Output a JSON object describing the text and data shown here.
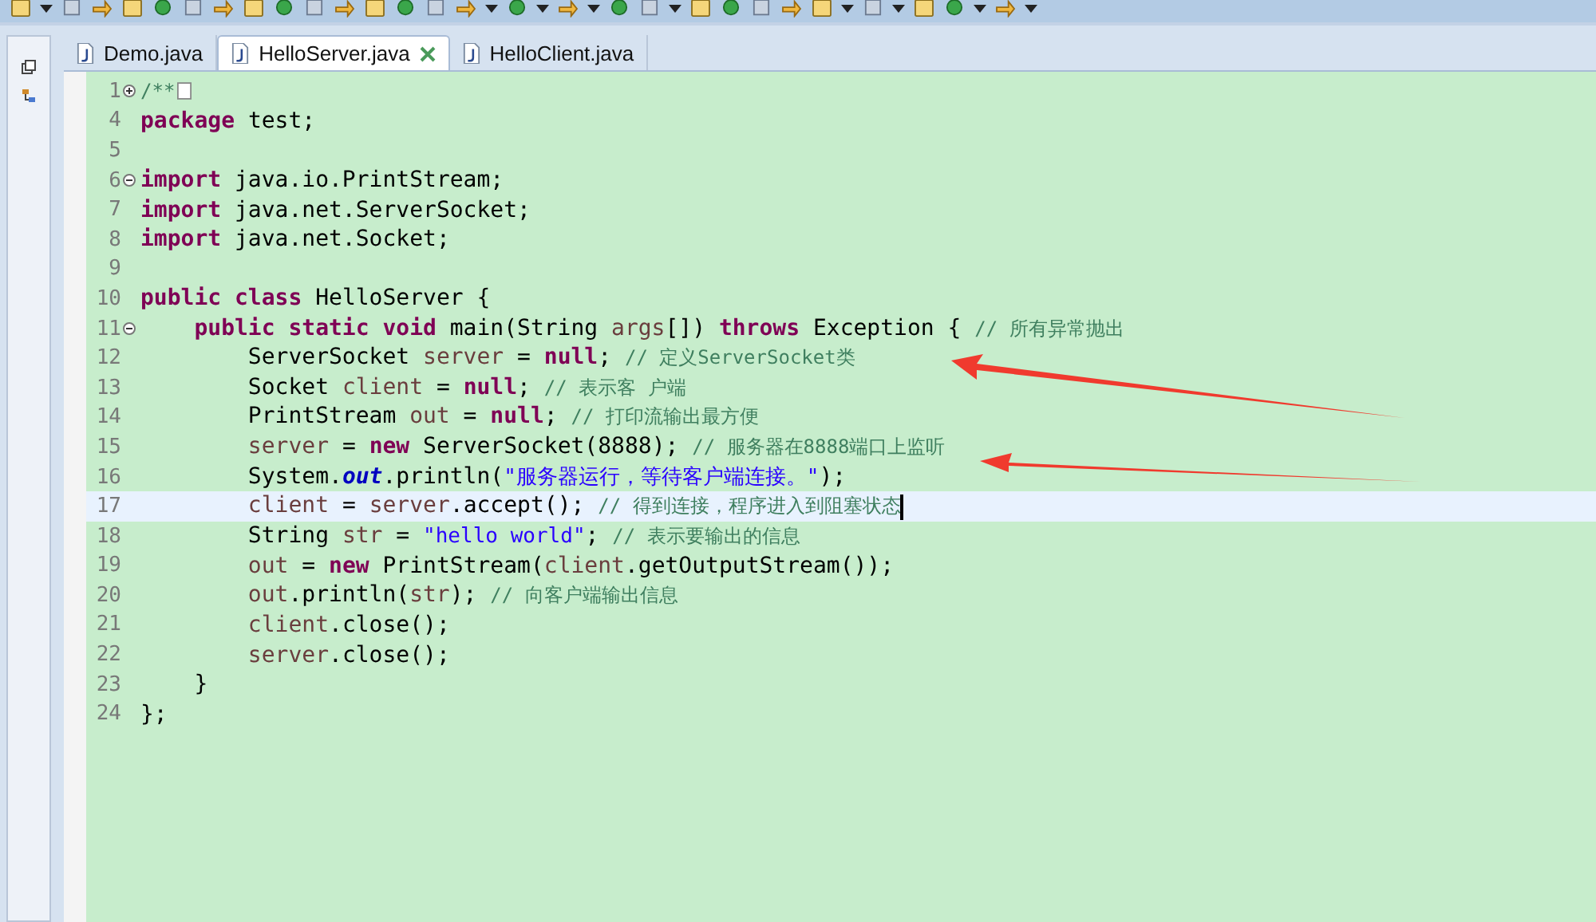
{
  "tabs": [
    {
      "label": "Demo.java",
      "selected": false
    },
    {
      "label": "HelloServer.java",
      "selected": true
    },
    {
      "label": "HelloClient.java",
      "selected": false
    }
  ],
  "editor": {
    "lines": [
      {
        "number": "1",
        "expanded": false,
        "tokens": [
          {
            "kind": "comment",
            "text": "/**"
          }
        ]
      },
      {
        "number": "4",
        "tokens": [
          {
            "kind": "keyword",
            "text": "package"
          },
          {
            "kind": "text",
            "text": " test;"
          }
        ]
      },
      {
        "number": "5"
      },
      {
        "number": "6",
        "expanded": true,
        "tokens": [
          {
            "kind": "keyword",
            "text": "import"
          },
          {
            "kind": "text",
            "text": " java.io.PrintStream;"
          }
        ]
      },
      {
        "number": "7",
        "tokens": [
          {
            "kind": "keyword",
            "text": "import"
          },
          {
            "kind": "text",
            "text": " java.net.ServerSocket;"
          }
        ]
      },
      {
        "number": "8",
        "tokens": [
          {
            "kind": "keyword",
            "text": "import"
          },
          {
            "kind": "text",
            "text": " java.net.Socket;"
          }
        ]
      },
      {
        "number": "9"
      },
      {
        "number": "10",
        "tokens": [
          {
            "kind": "keyword",
            "text": "public class"
          },
          {
            "kind": "text",
            "text": " HelloServer {"
          }
        ]
      },
      {
        "number": "11",
        "expanded": true,
        "tokens": [
          {
            "kind": "keyword",
            "text": "    public static void"
          },
          {
            "kind": "text",
            "text": " main(String "
          },
          {
            "kind": "variable",
            "text": "args"
          },
          {
            "kind": "text",
            "text": "[]) "
          },
          {
            "kind": "keyword",
            "text": "throws"
          },
          {
            "kind": "text",
            "text": " Exception { "
          },
          {
            "kind": "comment",
            "text": "// 所有异常抛出"
          }
        ]
      },
      {
        "number": "12",
        "tokens": [
          {
            "kind": "text",
            "text": "        ServerSocket "
          },
          {
            "kind": "variable",
            "text": "server"
          },
          {
            "kind": "text",
            "text": " = "
          },
          {
            "kind": "keyword",
            "text": "null"
          },
          {
            "kind": "text",
            "text": "; "
          },
          {
            "kind": "comment",
            "text": "// 定义ServerSocket类"
          }
        ]
      },
      {
        "number": "13",
        "tokens": [
          {
            "kind": "text",
            "text": "        Socket "
          },
          {
            "kind": "variable",
            "text": "client"
          },
          {
            "kind": "text",
            "text": " = "
          },
          {
            "kind": "keyword",
            "text": "null"
          },
          {
            "kind": "text",
            "text": "; "
          },
          {
            "kind": "comment",
            "text": "// 表示客 户端"
          }
        ]
      },
      {
        "number": "14",
        "tokens": [
          {
            "kind": "text",
            "text": "        PrintStream "
          },
          {
            "kind": "variable",
            "text": "out"
          },
          {
            "kind": "text",
            "text": " = "
          },
          {
            "kind": "keyword",
            "text": "null"
          },
          {
            "kind": "text",
            "text": "; "
          },
          {
            "kind": "comment",
            "text": "// 打印流输出最方便"
          }
        ]
      },
      {
        "number": "15",
        "tokens": [
          {
            "kind": "variable",
            "text": "        server"
          },
          {
            "kind": "text",
            "text": " = "
          },
          {
            "kind": "keyword",
            "text": "new"
          },
          {
            "kind": "text",
            "text": " ServerSocket(8888); "
          },
          {
            "kind": "comment",
            "text": "// 服务器在8888端口上监听"
          }
        ]
      },
      {
        "number": "16",
        "tokens": [
          {
            "kind": "text",
            "text": "        System."
          },
          {
            "kind": "static",
            "text": "out"
          },
          {
            "kind": "text",
            "text": ".println("
          },
          {
            "kind": "string",
            "text": "\"服务器运行，等待客户端连接。\""
          },
          {
            "kind": "text",
            "text": ");"
          }
        ]
      },
      {
        "number": "17",
        "current": true,
        "tokens": [
          {
            "kind": "variable",
            "text": "        client"
          },
          {
            "kind": "text",
            "text": " = "
          },
          {
            "kind": "variable",
            "text": "server"
          },
          {
            "kind": "text",
            "text": ".accept(); "
          },
          {
            "kind": "comment",
            "text": "// 得到连接，程序进入到阻塞状态"
          }
        ]
      },
      {
        "number": "18",
        "tokens": [
          {
            "kind": "text",
            "text": "        String "
          },
          {
            "kind": "variable",
            "text": "str"
          },
          {
            "kind": "text",
            "text": " = "
          },
          {
            "kind": "string",
            "text": "\"hello world\""
          },
          {
            "kind": "text",
            "text": "; "
          },
          {
            "kind": "comment",
            "text": "// 表示要输出的信息"
          }
        ]
      },
      {
        "number": "19",
        "tokens": [
          {
            "kind": "variable",
            "text": "        out"
          },
          {
            "kind": "text",
            "text": " = "
          },
          {
            "kind": "keyword",
            "text": "new"
          },
          {
            "kind": "text",
            "text": " PrintStream("
          },
          {
            "kind": "variable",
            "text": "client"
          },
          {
            "kind": "text",
            "text": ".getOutputStream());"
          }
        ]
      },
      {
        "number": "20",
        "tokens": [
          {
            "kind": "variable",
            "text": "        out"
          },
          {
            "kind": "text",
            "text": ".println("
          },
          {
            "kind": "variable",
            "text": "str"
          },
          {
            "kind": "text",
            "text": "); "
          },
          {
            "kind": "comment",
            "text": "// 向客户端输出信息"
          }
        ]
      },
      {
        "number": "21",
        "tokens": [
          {
            "kind": "variable",
            "text": "        client"
          },
          {
            "kind": "text",
            "text": ".close();"
          }
        ]
      },
      {
        "number": "22",
        "tokens": [
          {
            "kind": "variable",
            "text": "        server"
          },
          {
            "kind": "text",
            "text": ".close();"
          }
        ]
      },
      {
        "number": "23",
        "tokens": [
          {
            "kind": "text",
            "text": "    }"
          }
        ]
      },
      {
        "number": "24",
        "tokens": [
          {
            "kind": "text",
            "text": "};"
          }
        ]
      }
    ]
  }
}
